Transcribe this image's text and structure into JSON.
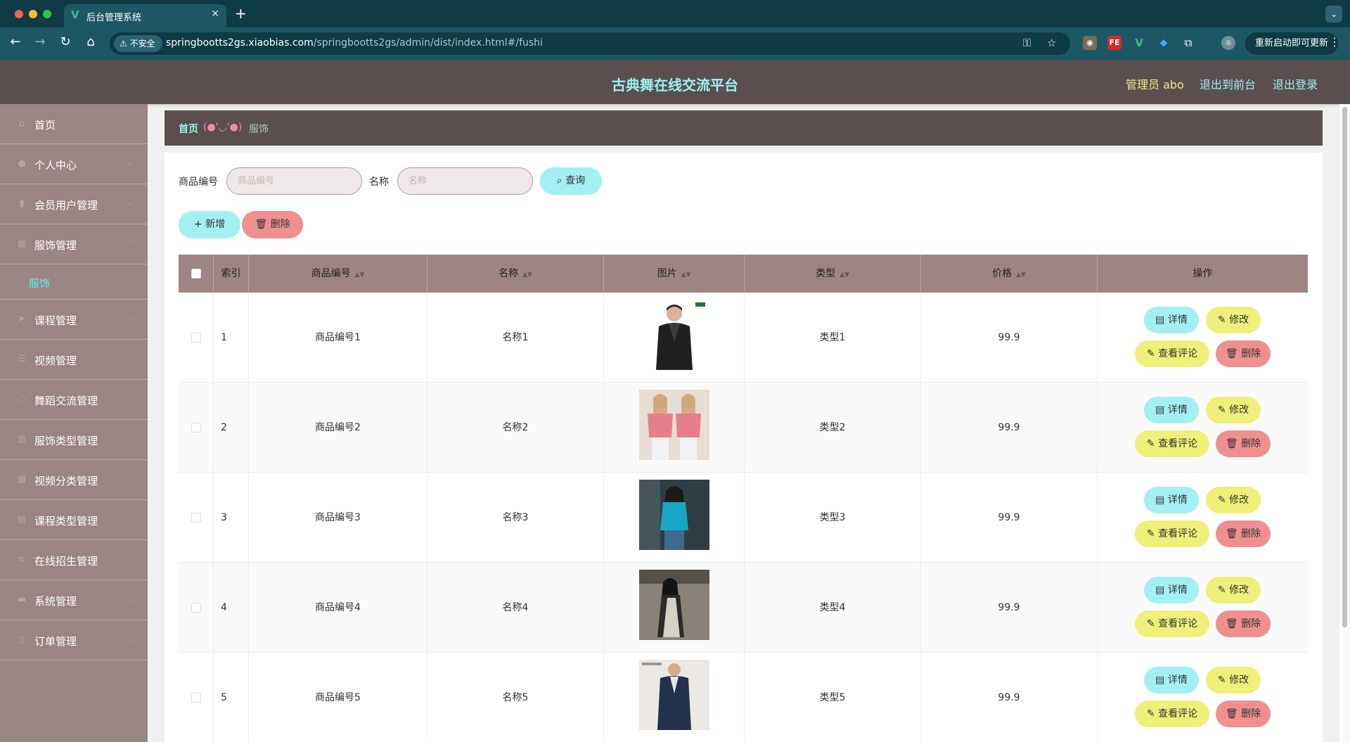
{
  "browser": {
    "tab_title": "后台管理系统",
    "url_host": "springbootts2gs.xiaobias.com",
    "url_path": "/springbootts2gs/admin/dist/index.html#/fushi",
    "insecure_label": "不安全",
    "update_button": "重新启动即可更新",
    "colors": {
      "tabbar": "#0f3b45",
      "toolbar": "#1c5864"
    }
  },
  "header": {
    "title": "古典舞在线交流平台",
    "user_label": "管理员 abo",
    "to_front": "退出到前台",
    "logout": "退出登录"
  },
  "sidebar": {
    "items": [
      {
        "label": "首页",
        "icon": "home-icon"
      },
      {
        "label": "个人中心",
        "icon": "user-icon"
      },
      {
        "label": "会员用户管理",
        "icon": "users-icon"
      },
      {
        "label": "服饰管理",
        "icon": "shirt-icon"
      },
      {
        "label": "课程管理",
        "icon": "book-icon"
      },
      {
        "label": "视频管理",
        "icon": "video-icon"
      },
      {
        "label": "舞蹈交流管理",
        "icon": "chat-icon"
      },
      {
        "label": "服饰类型管理",
        "icon": "chart-icon"
      },
      {
        "label": "视频分类管理",
        "icon": "grid-icon"
      },
      {
        "label": "课程类型管理",
        "icon": "tiles-icon"
      },
      {
        "label": "在线招生管理",
        "icon": "list-icon"
      },
      {
        "label": "系统管理",
        "icon": "gear-icon"
      },
      {
        "label": "订单管理",
        "icon": "order-icon"
      }
    ],
    "active_sub": "服饰"
  },
  "breadcrumb": {
    "home": "首页",
    "separator": "(●'◡'●)",
    "current": "服饰"
  },
  "search": {
    "code_label": "商品编号",
    "code_placeholder": "商品编号",
    "name_label": "名称",
    "name_placeholder": "名称",
    "query_button": "查询"
  },
  "actions": {
    "add_button": "新增",
    "delete_button": "删除"
  },
  "table": {
    "columns": [
      "索引",
      "商品编号",
      "名称",
      "图片",
      "类型",
      "价格",
      "操作"
    ],
    "row_actions": {
      "detail": "详情",
      "edit": "修改",
      "review": "查看评论",
      "delete": "删除"
    },
    "rows": [
      {
        "index": "1",
        "code": "商品编号1",
        "name": "名称1",
        "type": "类型1",
        "price": "99.9"
      },
      {
        "index": "2",
        "code": "商品编号2",
        "name": "名称2",
        "type": "类型2",
        "price": "99.9"
      },
      {
        "index": "3",
        "code": "商品编号3",
        "name": "名称3",
        "type": "类型3",
        "price": "99.9"
      },
      {
        "index": "4",
        "code": "商品编号4",
        "name": "名称4",
        "type": "类型4",
        "price": "99.9"
      },
      {
        "index": "5",
        "code": "商品编号5",
        "name": "名称5",
        "type": "类型5",
        "price": "99.9"
      }
    ]
  },
  "colors": {
    "accent_cyan": "#a3f0f2",
    "accent_yellow": "#eef07a",
    "accent_red": "#ef8f8f",
    "header_bg": "#5a4e4e",
    "sidebar_bg": "#9a8584"
  }
}
